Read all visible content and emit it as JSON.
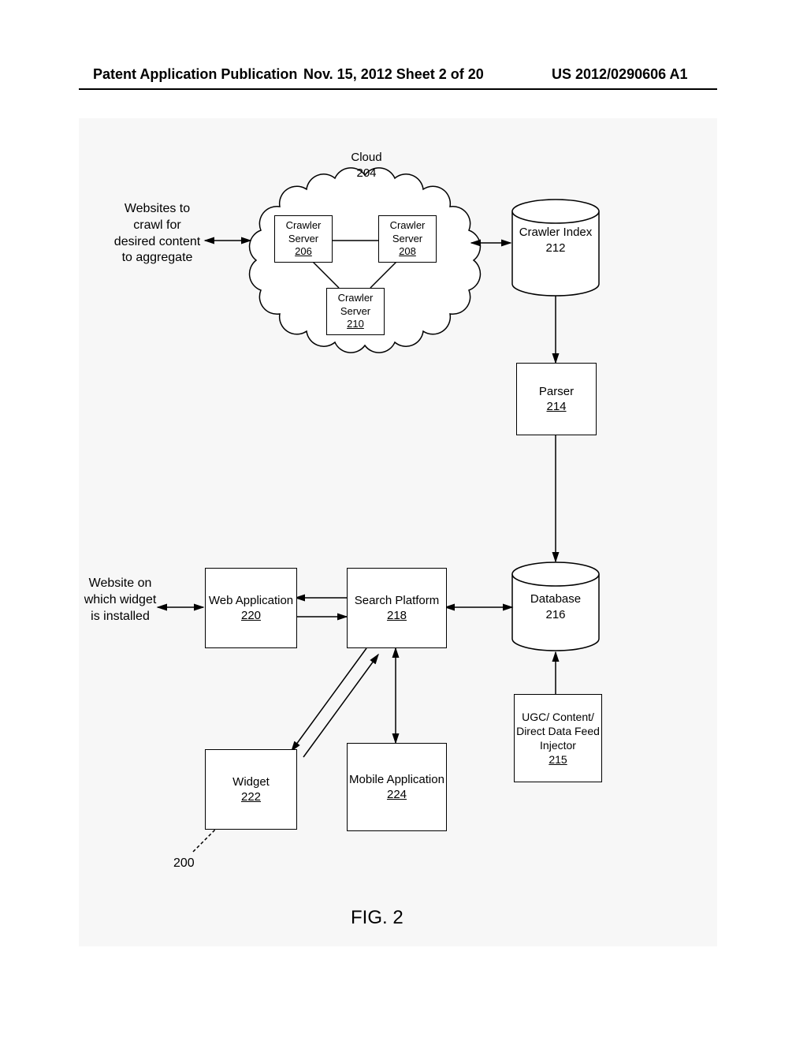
{
  "header": {
    "left": "Patent Application Publication",
    "center": "Nov. 15, 2012  Sheet 2 of 20",
    "right": "US 2012/0290606 A1"
  },
  "labels": {
    "websites_crawl": "Websites to crawl for desired content to aggregate",
    "website_widget": "Website on which widget is installed"
  },
  "cloud": {
    "title": "Cloud",
    "num": "204"
  },
  "crawler_server_1": {
    "title": "Crawler Server",
    "num": "206"
  },
  "crawler_server_2": {
    "title": "Crawler Server",
    "num": "208"
  },
  "crawler_server_3": {
    "title": "Crawler Server",
    "num": "210"
  },
  "crawler_index": {
    "title": "Crawler Index",
    "num": "212"
  },
  "parser": {
    "title": "Parser",
    "num": "214"
  },
  "database": {
    "title": "Database",
    "num": "216"
  },
  "injector": {
    "title": "UGC/ Content/ Direct Data Feed Injector",
    "num": "215"
  },
  "search_platform": {
    "title": "Search Platform",
    "num": "218"
  },
  "web_app": {
    "title": "Web Application",
    "num": "220"
  },
  "widget": {
    "title": "Widget",
    "num": "222"
  },
  "mobile_app": {
    "title": "Mobile Application",
    "num": "224"
  },
  "ref_200": "200",
  "figure_caption": "FIG. 2",
  "chart_data": {
    "type": "diagram",
    "nodes": [
      {
        "id": "204",
        "label": "Cloud",
        "shape": "cloud"
      },
      {
        "id": "206",
        "label": "Crawler Server",
        "parent": "204",
        "shape": "box"
      },
      {
        "id": "208",
        "label": "Crawler Server",
        "parent": "204",
        "shape": "box"
      },
      {
        "id": "210",
        "label": "Crawler Server",
        "parent": "204",
        "shape": "box"
      },
      {
        "id": "212",
        "label": "Crawler Index",
        "shape": "cylinder"
      },
      {
        "id": "214",
        "label": "Parser",
        "shape": "box"
      },
      {
        "id": "216",
        "label": "Database",
        "shape": "cylinder"
      },
      {
        "id": "215",
        "label": "UGC/ Content/ Direct Data Feed Injector",
        "shape": "box"
      },
      {
        "id": "218",
        "label": "Search Platform",
        "shape": "box"
      },
      {
        "id": "220",
        "label": "Web Application",
        "shape": "box"
      },
      {
        "id": "222",
        "label": "Widget",
        "shape": "box"
      },
      {
        "id": "224",
        "label": "Mobile Application",
        "shape": "box"
      }
    ],
    "edges": [
      {
        "from": "Websites to crawl for desired content to aggregate",
        "to": "204",
        "dir": "both"
      },
      {
        "from": "206",
        "to": "208",
        "dir": "none"
      },
      {
        "from": "206",
        "to": "210",
        "dir": "none"
      },
      {
        "from": "208",
        "to": "210",
        "dir": "none"
      },
      {
        "from": "208",
        "to": "212",
        "dir": "both"
      },
      {
        "from": "212",
        "to": "214",
        "dir": "forward"
      },
      {
        "from": "214",
        "to": "216",
        "dir": "forward"
      },
      {
        "from": "215",
        "to": "216",
        "dir": "forward"
      },
      {
        "from": "216",
        "to": "218",
        "dir": "both"
      },
      {
        "from": "218",
        "to": "220",
        "dir": "both"
      },
      {
        "from": "Website on which widget is installed",
        "to": "220",
        "dir": "both"
      },
      {
        "from": "218",
        "to": "222",
        "dir": "both"
      },
      {
        "from": "218",
        "to": "224",
        "dir": "both"
      }
    ],
    "reference_numeral": "200",
    "caption": "FIG. 2"
  }
}
